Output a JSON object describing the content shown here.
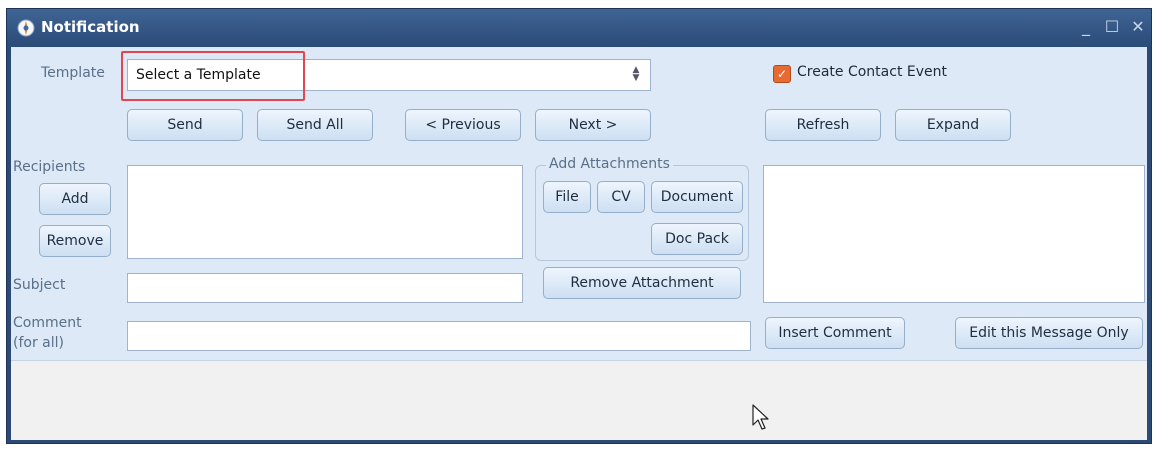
{
  "window": {
    "title": "Notification",
    "controls": {
      "minimize": "_",
      "maximize": "☐",
      "close": "✕"
    }
  },
  "template": {
    "label": "Template",
    "selected": "Select a Template"
  },
  "create_contact_event": {
    "label": "Create Contact Event",
    "checked": true
  },
  "nav_buttons": {
    "send": "Send",
    "send_all": "Send All",
    "previous": "< Previous",
    "next": "Next >",
    "refresh": "Refresh",
    "expand": "Expand"
  },
  "recipients": {
    "label": "Recipients",
    "add": "Add",
    "remove": "Remove"
  },
  "attachments": {
    "legend": "Add Attachments",
    "file": "File",
    "cv": "CV",
    "document": "Document",
    "doc_pack": "Doc Pack",
    "remove": "Remove Attachment"
  },
  "subject": {
    "label": "Subject"
  },
  "comment": {
    "label_line1": "Comment",
    "label_line2": "(for all)"
  },
  "buttons": {
    "insert_comment": "Insert Comment",
    "edit_message": "Edit this Message Only"
  },
  "colors": {
    "title_bar": "#2c4a74",
    "panel": "#dde9f6",
    "highlight": "#e2474f",
    "checkbox": "#e76a33"
  }
}
